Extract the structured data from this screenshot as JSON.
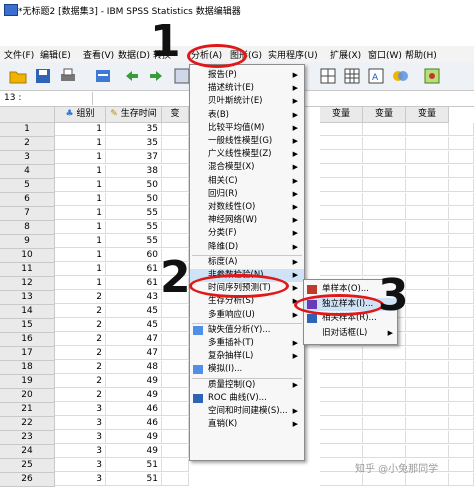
{
  "window": {
    "title": "*无标题2 [数据集3] - IBM SPSS Statistics 数据编辑器"
  },
  "menubar": [
    {
      "label": "文件(F)"
    },
    {
      "label": "编辑(E)"
    },
    {
      "label": "查看(V)"
    },
    {
      "label": "数据(D)"
    },
    {
      "label": "转换"
    },
    {
      "label": "分析(A)"
    },
    {
      "label": "图形(G)"
    },
    {
      "label": "实用程序(U)"
    },
    {
      "label": "扩展(X)"
    },
    {
      "label": "窗口(W)"
    },
    {
      "label": "帮助(H)"
    }
  ],
  "cellref": {
    "label": "13 :"
  },
  "grid": {
    "columns": [
      {
        "label": "组别",
        "icon": "nominal-icon"
      },
      {
        "label": "生存时间",
        "icon": "scale-icon"
      },
      {
        "label": "变"
      }
    ],
    "right_columns": [
      "变量",
      "变量",
      "变量"
    ],
    "rows": [
      {
        "n": "1",
        "g": "1",
        "t": "35"
      },
      {
        "n": "2",
        "g": "1",
        "t": "35"
      },
      {
        "n": "3",
        "g": "1",
        "t": "37"
      },
      {
        "n": "4",
        "g": "1",
        "t": "38"
      },
      {
        "n": "5",
        "g": "1",
        "t": "50"
      },
      {
        "n": "6",
        "g": "1",
        "t": "50"
      },
      {
        "n": "7",
        "g": "1",
        "t": "55"
      },
      {
        "n": "8",
        "g": "1",
        "t": "55"
      },
      {
        "n": "9",
        "g": "1",
        "t": "55"
      },
      {
        "n": "10",
        "g": "1",
        "t": "60"
      },
      {
        "n": "11",
        "g": "1",
        "t": "61"
      },
      {
        "n": "12",
        "g": "1",
        "t": "61"
      },
      {
        "n": "13",
        "g": "2",
        "t": "43"
      },
      {
        "n": "14",
        "g": "2",
        "t": "45"
      },
      {
        "n": "15",
        "g": "2",
        "t": "45"
      },
      {
        "n": "16",
        "g": "2",
        "t": "47"
      },
      {
        "n": "17",
        "g": "2",
        "t": "47"
      },
      {
        "n": "18",
        "g": "2",
        "t": "48"
      },
      {
        "n": "19",
        "g": "2",
        "t": "49"
      },
      {
        "n": "20",
        "g": "2",
        "t": "49"
      },
      {
        "n": "21",
        "g": "3",
        "t": "46"
      },
      {
        "n": "22",
        "g": "3",
        "t": "46"
      },
      {
        "n": "23",
        "g": "3",
        "t": "49"
      },
      {
        "n": "24",
        "g": "3",
        "t": "49"
      },
      {
        "n": "25",
        "g": "3",
        "t": "51"
      },
      {
        "n": "26",
        "g": "3",
        "t": "51"
      }
    ]
  },
  "analyze_menu": {
    "items": [
      {
        "label": "报告(P)",
        "arrow": true
      },
      {
        "label": "描述统计(E)",
        "arrow": true
      },
      {
        "label": "贝叶斯统计(E)",
        "arrow": true
      },
      {
        "label": "表(B)",
        "arrow": true
      },
      {
        "label": "比较平均值(M)",
        "arrow": true
      },
      {
        "label": "一般线性模型(G)",
        "arrow": true
      },
      {
        "label": "广义线性模型(Z)",
        "arrow": true
      },
      {
        "label": "混合模型(X)",
        "arrow": true
      },
      {
        "label": "相关(C)",
        "arrow": true
      },
      {
        "label": "回归(R)",
        "arrow": true
      },
      {
        "label": "对数线性(O)",
        "arrow": true
      },
      {
        "label": "神经网络(W)",
        "arrow": true
      },
      {
        "label": "分类(F)",
        "arrow": true
      },
      {
        "label": "降维(D)",
        "arrow": true
      },
      {
        "label": "标度(A)",
        "arrow": true
      },
      {
        "label": "非参数检验(N)",
        "arrow": true
      },
      {
        "label": "时间序列预测(T)",
        "arrow": true
      },
      {
        "label": "生存分析(S)",
        "arrow": true
      },
      {
        "label": "多重响应(U)",
        "arrow": true
      },
      {
        "label": "缺失值分析(Y)...",
        "arrow": false,
        "icon": "missing-values-icon"
      },
      {
        "label": "多重插补(T)",
        "arrow": true
      },
      {
        "label": "复杂抽样(L)",
        "arrow": true
      },
      {
        "label": "模拟(I)...",
        "arrow": false,
        "icon": "simulation-icon"
      },
      {
        "label": "质量控制(Q)",
        "arrow": true
      },
      {
        "label": "ROC 曲线(V)...",
        "arrow": false,
        "icon": "roc-icon"
      },
      {
        "label": "空间和时间建模(S)...",
        "arrow": true
      },
      {
        "label": "直销(K)",
        "arrow": true
      }
    ]
  },
  "nonparam_submenu": {
    "items": [
      {
        "label": "单样本(O)...",
        "icon": "one-sample-icon"
      },
      {
        "label": "独立样本(I)...",
        "icon": "independent-samples-icon"
      },
      {
        "label": "相关样本(R)...",
        "icon": "related-samples-icon"
      },
      {
        "label": "旧对话框(L)",
        "arrow": true
      }
    ]
  },
  "annotations": {
    "step1": "1",
    "step2": "2",
    "step3": "3"
  },
  "watermark": "知乎 @小兔那同学",
  "colors": {
    "highlight_ring": "#e01818",
    "menu_hover": "#cfe3f7"
  }
}
